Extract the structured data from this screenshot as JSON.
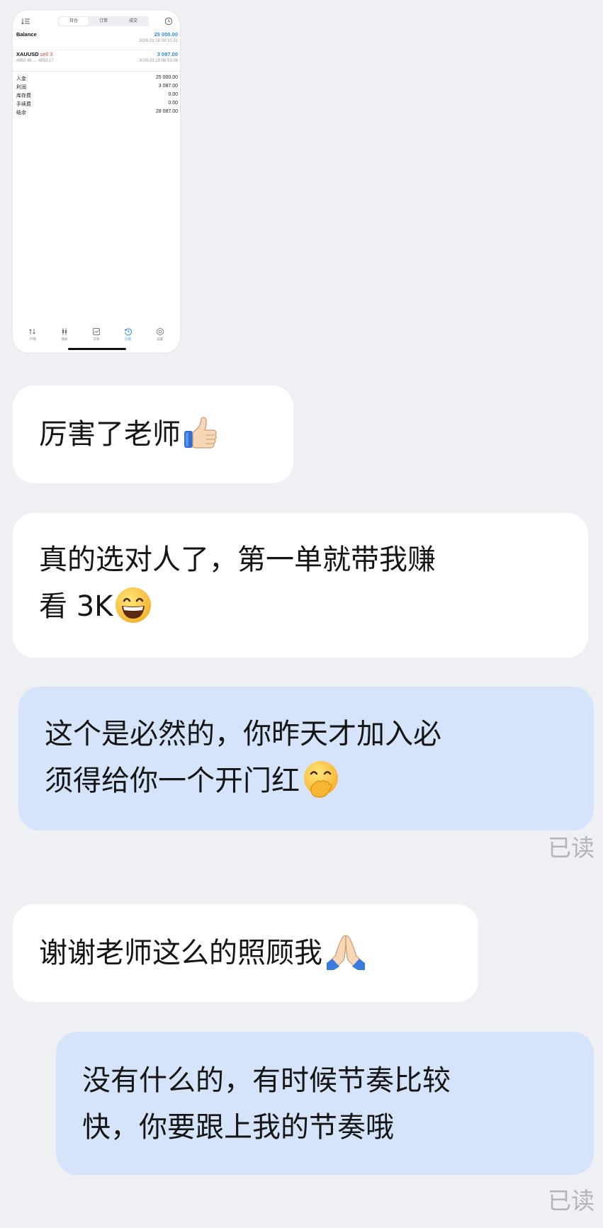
{
  "screenshot": {
    "tabs": [
      "持仓",
      "订单",
      "成交"
    ],
    "active_tab_index": 0,
    "balance": {
      "label": "Balance",
      "amount": "25 000.00",
      "time": "2026.03.18 08:10:31"
    },
    "trade": {
      "symbol": "XAUUSD",
      "side": "sell 3",
      "prices": "4863.46 → 4853.17",
      "profit": "3 087.00",
      "time": "2026.03.19 06:53:06"
    },
    "summary": [
      {
        "label": "入金",
        "value": "25 000.00"
      },
      {
        "label": "利润",
        "value": "3 087.00"
      },
      {
        "label": "库存费",
        "value": "0.00"
      },
      {
        "label": "手续费",
        "value": "0.00"
      },
      {
        "label": "结余",
        "value": "28 087.00"
      }
    ],
    "bottom_tabs": [
      {
        "label": "行情",
        "icon": "quotes-icon"
      },
      {
        "label": "图表",
        "icon": "candles-icon"
      },
      {
        "label": "交易",
        "icon": "trade-chart-icon"
      },
      {
        "label": "历史",
        "icon": "history-icon",
        "active": true
      },
      {
        "label": "设置",
        "icon": "settings-icon"
      }
    ],
    "accent_color": "#2d8bd6",
    "sell_color": "#e04545"
  },
  "messages": [
    {
      "from": "other",
      "lines": [
        "厉害了老师"
      ],
      "emoji": "thumbs-up-icon"
    },
    {
      "from": "other",
      "lines": [
        "真的选对人了，第一单就带我赚",
        "看 3K"
      ],
      "emoji": "grinning-face-icon"
    },
    {
      "from": "me",
      "lines": [
        "这个是必然的，你昨天才加入必",
        "须得给你一个开门红"
      ],
      "emoji": "hand-over-mouth-face-icon",
      "status": "已读"
    },
    {
      "from": "other",
      "lines": [
        "谢谢老师这么的照顾我"
      ],
      "emoji": "folded-hands-icon"
    },
    {
      "from": "me",
      "lines": [
        "没有什么的，有时候节奏比较",
        "快，你要跟上我的节奏哦"
      ],
      "status": "已读"
    }
  ],
  "colors": {
    "background": "#eff0f4",
    "incoming_bubble": "#ffffff",
    "outgoing_bubble": "#d6e4fb",
    "read_status": "#b3b5ba"
  }
}
